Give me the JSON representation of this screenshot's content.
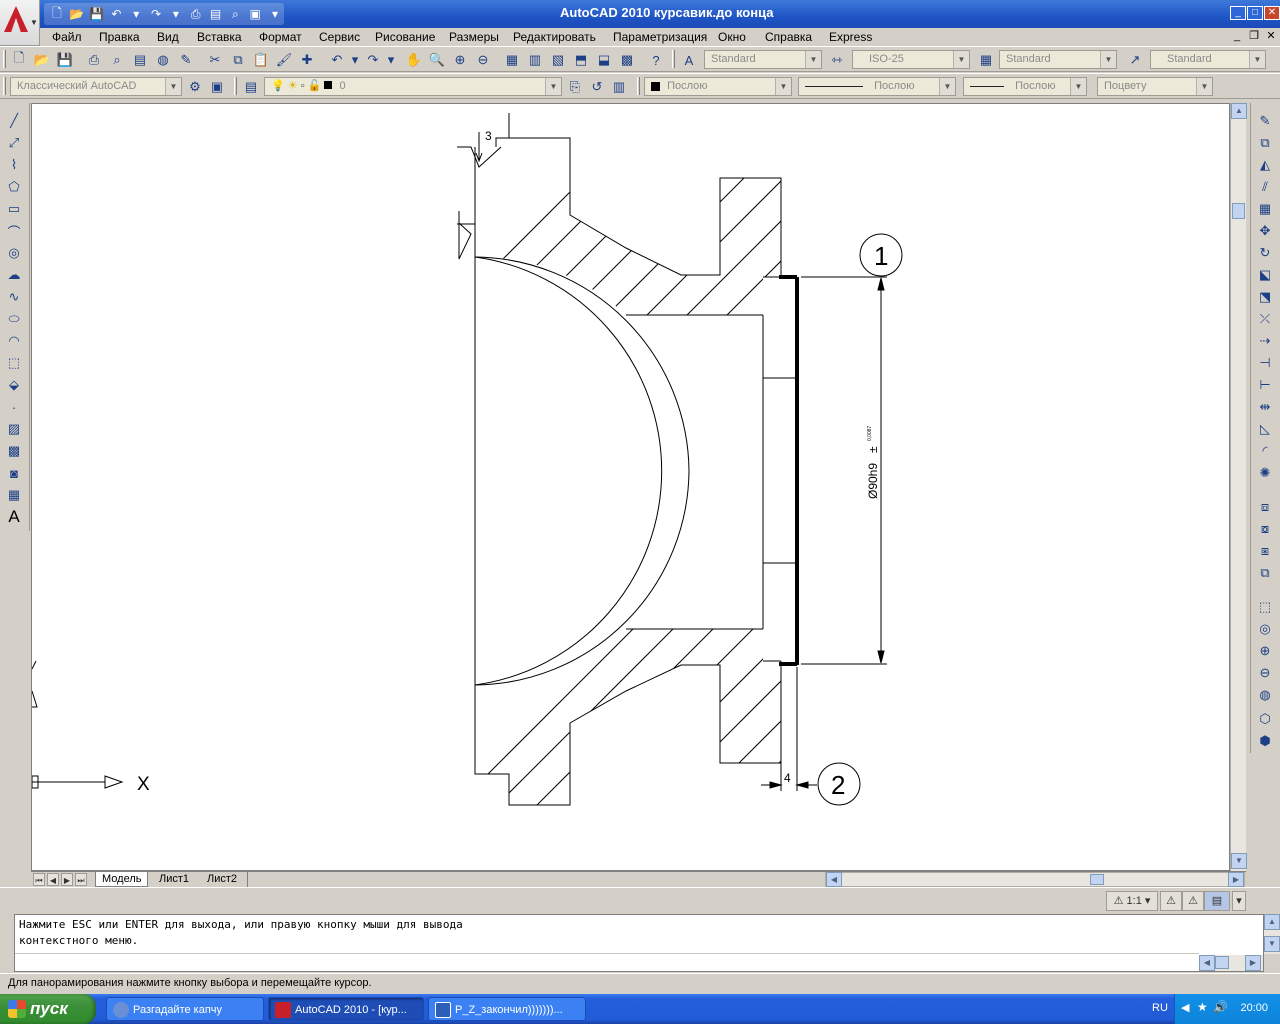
{
  "window": {
    "title": "AutoCAD 2010     курсавик.до конца"
  },
  "menu": {
    "items": [
      "Файл",
      "Правка",
      "Вид",
      "Вставка",
      "Формат",
      "Сервис",
      "Рисование",
      "Размеры",
      "Редактировать",
      "Параметризация",
      "Окно",
      "Справка",
      "Express"
    ]
  },
  "toolbar_styles": {
    "text_style": "Standard",
    "dim_style": "ISO-25",
    "table_style": "Standard",
    "multileader_style": "Standard"
  },
  "toolbar_layers": {
    "workspace": "Классический AutoCAD",
    "layer": "0",
    "color": "Послою",
    "linetype": "Послою",
    "lineweight": "Послою",
    "plotstyle": "Поцвету"
  },
  "drawing": {
    "roughness_label": "3",
    "balloon_1": "1",
    "balloon_2": "2",
    "dim_4": "4",
    "diameter_dim": "Ø90h9",
    "diameter_tol": "±",
    "diameter_tol_small": "0,0087",
    "ucs_x": "X",
    "ucs_y": "Y"
  },
  "tabs": {
    "items": [
      "Модель",
      "Лист1",
      "Лист2"
    ],
    "active": "Модель"
  },
  "annotation": {
    "scale": "1:1"
  },
  "command": {
    "line1": "Нажмите ESC или ENTER для выхода, или правую кнопку мыши для вывода",
    "line2": "контекстного меню."
  },
  "status": {
    "text": "Для панорамирования нажмите кнопку выбора и перемещайте курсор."
  },
  "taskbar": {
    "start": "пуск",
    "tasks": [
      "Разгадайте капчу",
      "AutoCAD 2010 - [кур...",
      "P_Z_закончил)))))))..."
    ],
    "language": "RU",
    "clock": "20:00"
  }
}
